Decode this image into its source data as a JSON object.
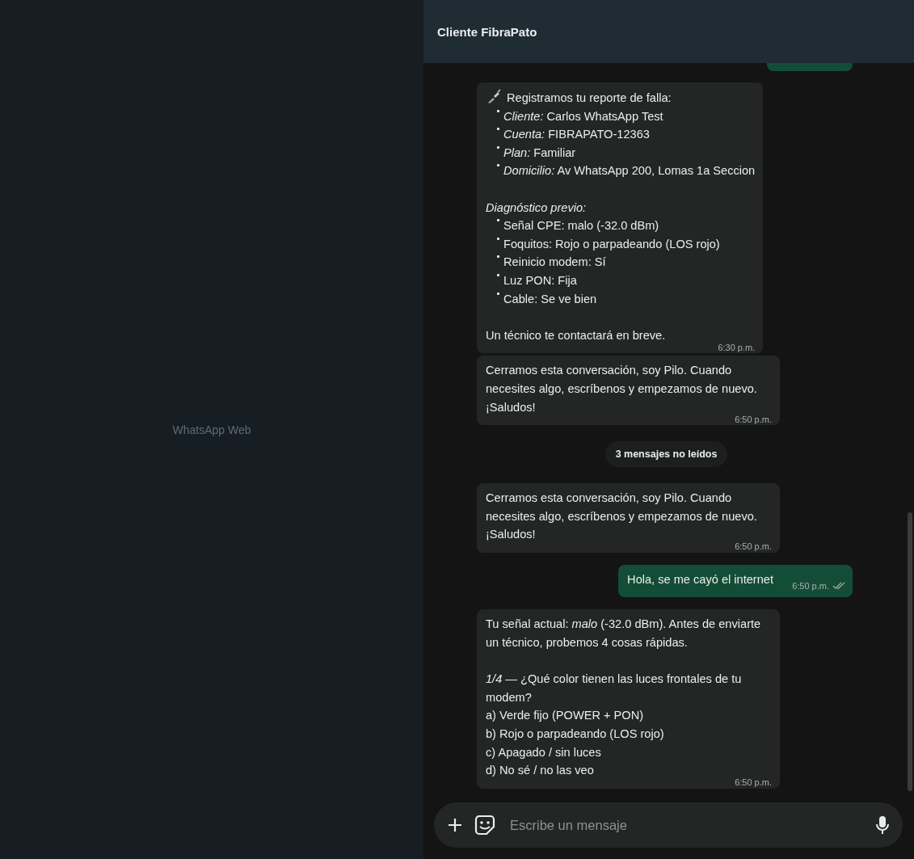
{
  "sidebar": {
    "title": "WhatsApp Web"
  },
  "chat": {
    "title": "Cliente FibraPato",
    "messages": [
      {
        "kind": "outgoing",
        "clipped": true
      },
      {
        "kind": "incoming",
        "time": "6:30 p.m.",
        "paragraphs": [
          {
            "lines": [
              {
                "kind": "icon",
                "text": "Registramos tu reporte de falla:"
              },
              {
                "kind": "bullet",
                "text": "*Cliente:* Carlos WhatsApp Test"
              },
              {
                "kind": "bullet",
                "text": "*Cuenta:* FIBRAPATO-12363"
              },
              {
                "kind": "bullet",
                "text": "*Plan:* Familiar"
              },
              {
                "kind": "bullet",
                "text": "*Domicilio:* Av WhatsApp 200, Lomas 1a Seccion"
              }
            ]
          },
          {
            "lines": [
              {
                "kind": "text",
                "text": "*Diagnóstico previo:*"
              },
              {
                "kind": "bullet",
                "text": "Señal CPE: malo (-32.0 dBm)"
              },
              {
                "kind": "bullet",
                "text": "Foquitos: Rojo o parpadeando (LOS rojo)"
              },
              {
                "kind": "bullet",
                "text": "Reinicio modem: Sí"
              },
              {
                "kind": "bullet",
                "text": "Luz PON: Fija"
              },
              {
                "kind": "bullet",
                "text": "Cable: Se ve bien"
              }
            ]
          },
          {
            "lines": [
              {
                "kind": "text",
                "text": "Un técnico te contactará en breve."
              }
            ]
          }
        ]
      },
      {
        "kind": "incoming",
        "time": "6:50 p.m.",
        "paragraphs": [
          {
            "lines": [
              {
                "kind": "text",
                "text": "Cerramos esta conversación, soy Pilo. Cuando necesites algo, escríbenos y empezamos de nuevo. ¡Saludos!"
              }
            ]
          }
        ]
      },
      {
        "kind": "unread",
        "text": "3 mensajes no leídos"
      },
      {
        "kind": "incoming",
        "time": "6:50 p.m.",
        "paragraphs": [
          {
            "lines": [
              {
                "kind": "text",
                "text": "Cerramos esta conversación, soy Pilo. Cuando necesites algo, escríbenos y empezamos de nuevo. ¡Saludos!"
              }
            ]
          }
        ]
      },
      {
        "kind": "outgoing",
        "time": "6:50 p.m.",
        "read": false,
        "paragraphs": [
          {
            "lines": [
              {
                "kind": "text",
                "text": "Hola, se me cayó el internet"
              }
            ]
          }
        ]
      },
      {
        "kind": "incoming",
        "time": "6:50 p.m.",
        "paragraphs": [
          {
            "lines": [
              {
                "kind": "text",
                "text": "Tu señal actual: *malo* (-32.0 dBm). Antes de enviarte un técnico, probemos 4 cosas rápidas."
              }
            ]
          },
          {
            "lines": [
              {
                "kind": "text",
                "text": "*1/4* — ¿Qué color tienen las luces frontales de tu modem?"
              },
              {
                "kind": "text",
                "text": "a) Verde fijo (POWER + PON)"
              },
              {
                "kind": "text",
                "text": "b) Rojo o parpadeando (LOS rojo)"
              },
              {
                "kind": "text",
                "text": "c) Apagado / sin luces"
              },
              {
                "kind": "text",
                "text": "d) No sé / no las veo"
              }
            ]
          }
        ]
      }
    ]
  },
  "composer": {
    "placeholder": "Escribe un mensaje"
  }
}
